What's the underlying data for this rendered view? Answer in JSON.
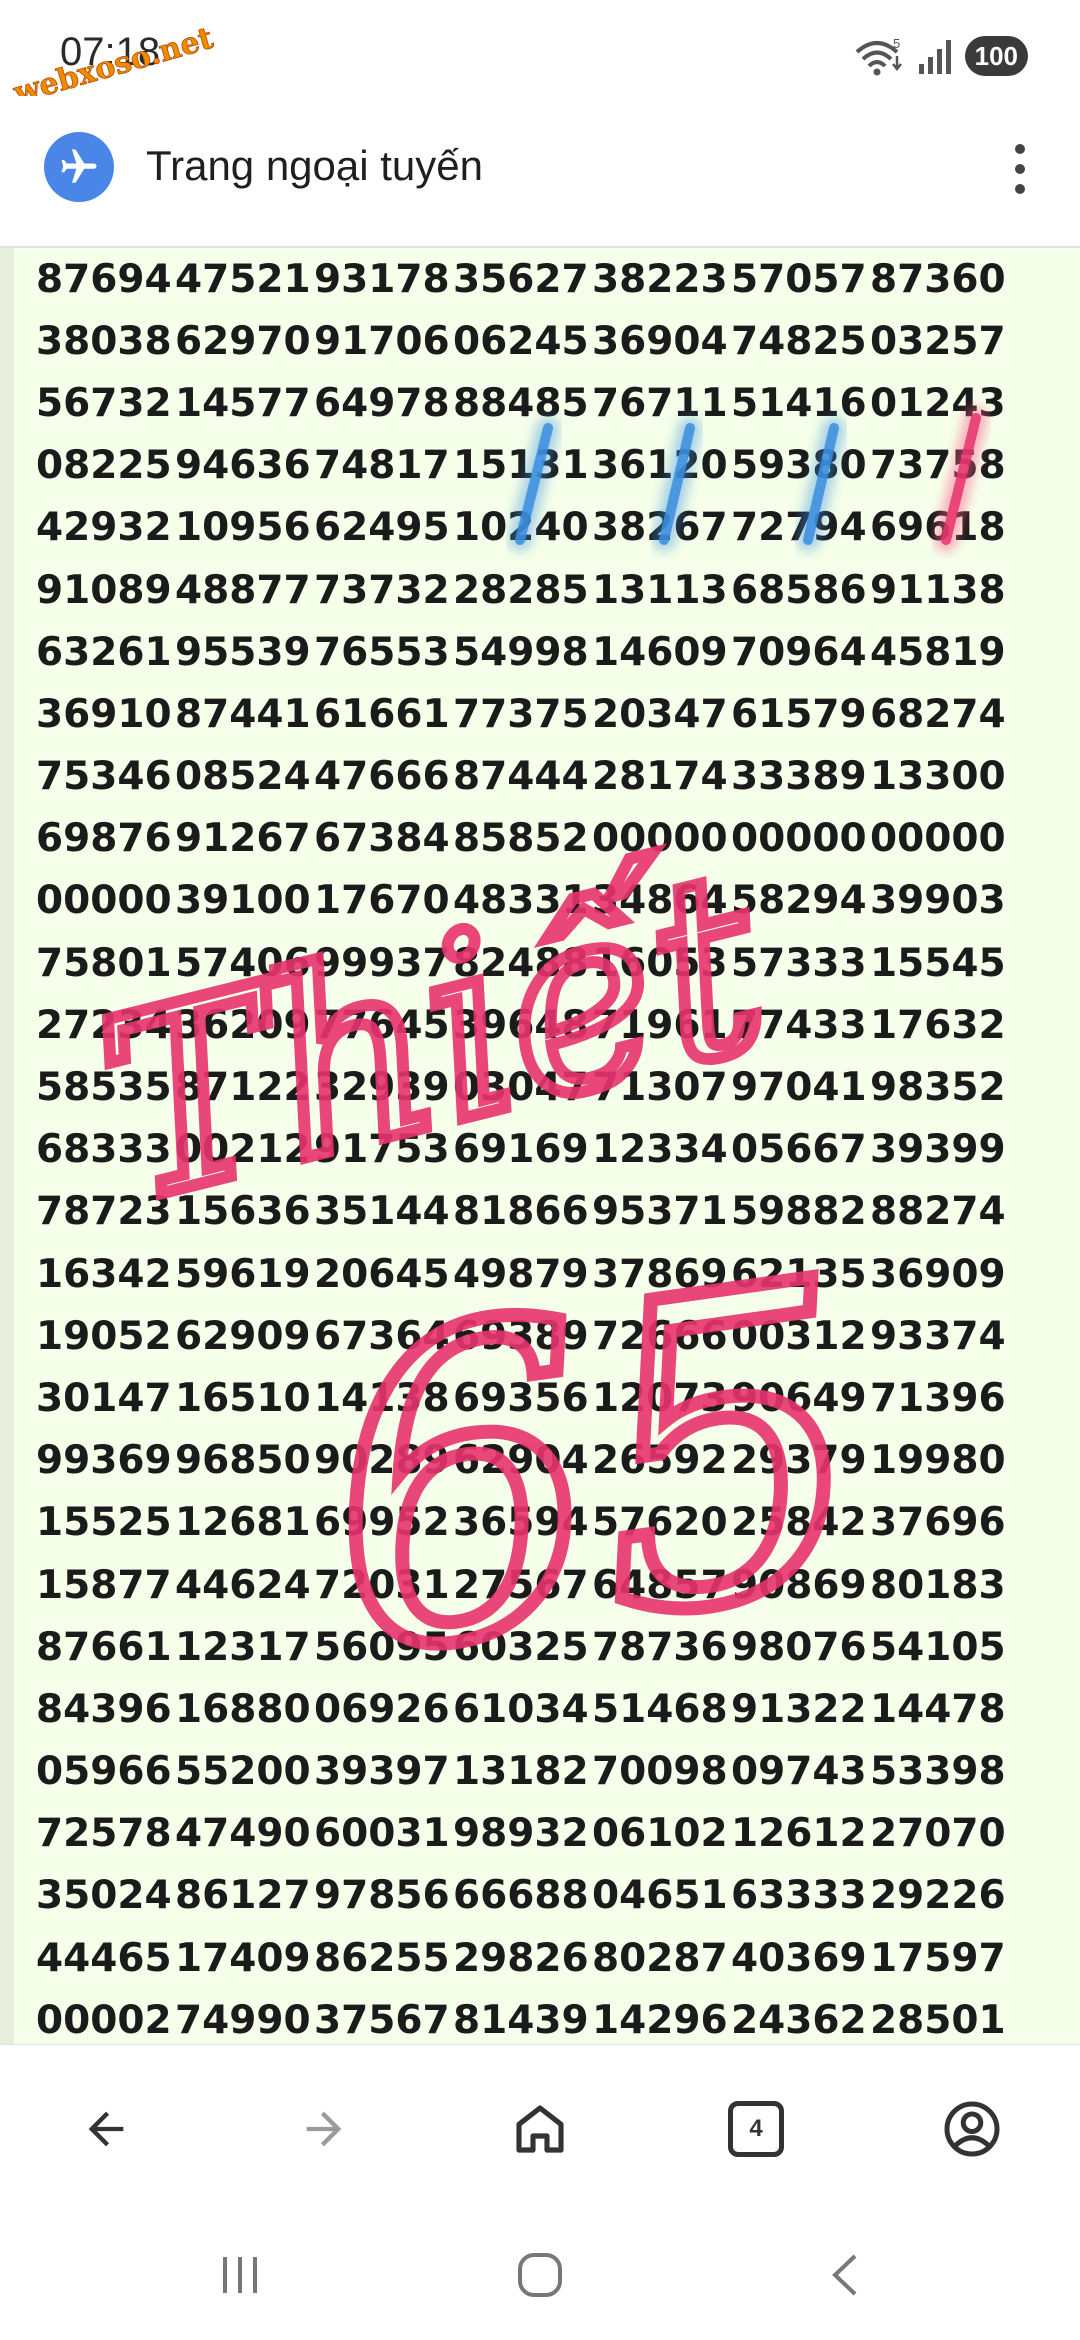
{
  "status_bar": {
    "time": "07:18",
    "watermark_text": "webxoso.net",
    "wifi_label": "5",
    "battery": "100"
  },
  "app_bar": {
    "title": "Trang ngoại tuyến"
  },
  "content": {
    "rows": [
      [
        "87694",
        "47521",
        "93178",
        "35627",
        "38223",
        "57057",
        "87360"
      ],
      [
        "38038",
        "62970",
        "91706",
        "06245",
        "36904",
        "74825",
        "03257"
      ],
      [
        "56732",
        "14577",
        "64978",
        "88485",
        "76711",
        "51416",
        "01243"
      ],
      [
        "08225",
        "94636",
        "74817",
        "15131",
        "36120",
        "59380",
        "73758"
      ],
      [
        "42932",
        "10956",
        "62495",
        "10240",
        "38267",
        "72794",
        "69618"
      ],
      [
        "91089",
        "48877",
        "73732",
        "28285",
        "13113",
        "68586",
        "91138"
      ],
      [
        "63261",
        "95539",
        "76553",
        "54998",
        "14609",
        "70964",
        "45819"
      ],
      [
        "36910",
        "87441",
        "61661",
        "77375",
        "20347",
        "61579",
        "68274"
      ],
      [
        "75346",
        "08524",
        "47666",
        "87444",
        "28174",
        "33389",
        "13300"
      ],
      [
        "69876",
        "91267",
        "67384",
        "85852",
        "00000",
        "00000",
        "00000"
      ],
      [
        "00000",
        "39100",
        "17670",
        "48331",
        "34864",
        "58294",
        "39903"
      ],
      [
        "75801",
        "57406",
        "99937",
        "82488",
        "16053",
        "57333",
        "15545"
      ],
      [
        "27234",
        "36209",
        "77645",
        "39648",
        "71961",
        "77433",
        "17632"
      ],
      [
        "58535",
        "87122",
        "32939",
        "03047",
        "71307",
        "97041",
        "98352"
      ],
      [
        "68333",
        "00212",
        "91753",
        "69169",
        "12334",
        "05667",
        "39399"
      ],
      [
        "78723",
        "15636",
        "35144",
        "81866",
        "95371",
        "59882",
        "88274"
      ],
      [
        "16342",
        "59619",
        "20645",
        "49879",
        "37869",
        "62135",
        "36909"
      ],
      [
        "19052",
        "62909",
        "67364",
        "69389",
        "72666",
        "00312",
        "93374"
      ],
      [
        "30147",
        "16510",
        "14138",
        "69356",
        "12073",
        "90649",
        "71396"
      ],
      [
        "99369",
        "96850",
        "90289",
        "62904",
        "26592",
        "29379",
        "19980"
      ],
      [
        "15525",
        "12681",
        "69952",
        "36594",
        "57620",
        "25842",
        "37696"
      ],
      [
        "15877",
        "44624",
        "72031",
        "27567",
        "64857",
        "90869",
        "80183"
      ],
      [
        "87661",
        "12317",
        "56095",
        "60325",
        "78736",
        "98076",
        "54105"
      ],
      [
        "84396",
        "16880",
        "06926",
        "61034",
        "51468",
        "91322",
        "14478"
      ],
      [
        "05966",
        "55200",
        "39397",
        "13182",
        "70098",
        "09743",
        "53398"
      ],
      [
        "72578",
        "47490",
        "60031",
        "98932",
        "06102",
        "12612",
        "27070"
      ],
      [
        "35024",
        "86127",
        "97856",
        "66688",
        "04651",
        "63333",
        "29226"
      ],
      [
        "44465",
        "17409",
        "86255",
        "29826",
        "80287",
        "40369",
        "17597"
      ],
      [
        "00002",
        "74990",
        "37567",
        "81439",
        "14296",
        "24362",
        "28501"
      ]
    ],
    "handwriting_word": "Thiết",
    "handwriting_number": "65"
  },
  "bottom_nav": {
    "tab_count": "4"
  },
  "colors": {
    "content_bg": "#f5ffe9",
    "ink_pink": "#e8336e",
    "highlight_blue": "#3a8fe0",
    "airplane_badge": "#4a86e8",
    "watermark_orange": "#f28a00"
  },
  "icons": [
    "airplane-icon",
    "more-vert-icon",
    "back-icon",
    "forward-icon",
    "home-icon",
    "tabs-icon",
    "account-icon",
    "recents-icon",
    "system-home-icon",
    "system-back-icon",
    "wifi-icon",
    "signal-icon"
  ]
}
